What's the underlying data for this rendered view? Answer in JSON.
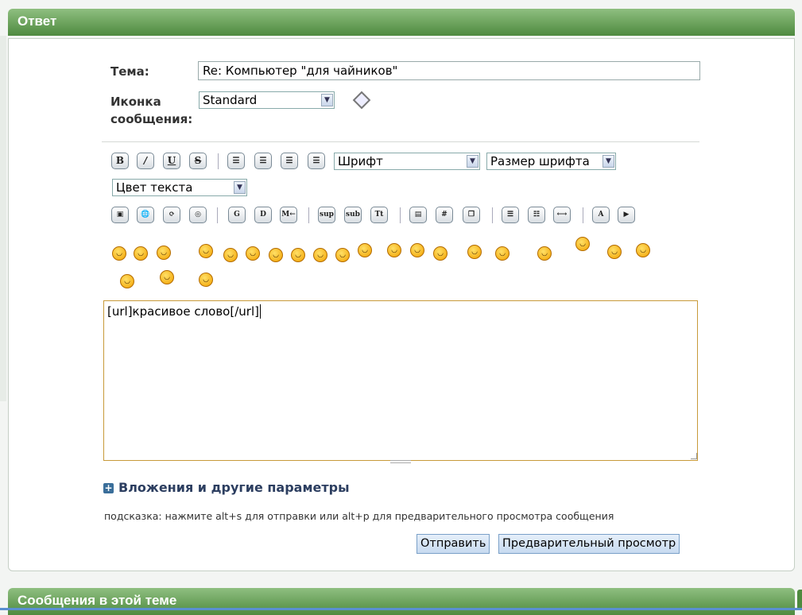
{
  "reply_panel": {
    "title": "Ответ"
  },
  "form": {
    "subject_label": "Тема:",
    "subject_value": "Re: Компьютер \"для чайников\"",
    "icon_label_line1": "Иконка",
    "icon_label_line2": "сообщения:",
    "icon_select_value": "Standard"
  },
  "toolbar": {
    "bold": "B",
    "italic": "/",
    "underline": "U",
    "strike": "S",
    "font_select": "Шрифт",
    "size_select": "Размер шрифта",
    "color_select": "Цвет текста",
    "row2": [
      "▣",
      "🌐",
      "⟳",
      "◎",
      "G",
      "D",
      "M←",
      "sup",
      "sub",
      "Tt",
      "▤",
      "#",
      "❐",
      "☰",
      "☷",
      "⟷",
      "A",
      "▶"
    ]
  },
  "editor": {
    "content": "[url]красивое слово[/url]"
  },
  "options": {
    "attachments_label": "Вложения и другие параметры",
    "hint": "подсказка: нажмите alt+s для отправки или alt+p для предварительного просмотра сообщения",
    "submit_label": "Отправить",
    "preview_label": "Предварительный просмотр"
  },
  "thread_panel": {
    "title": "Сообщения в этой теме"
  },
  "colors": {
    "header_green": "#4e8a3f",
    "button_blue": "#c7daf0",
    "editor_border": "#c89a3a"
  }
}
